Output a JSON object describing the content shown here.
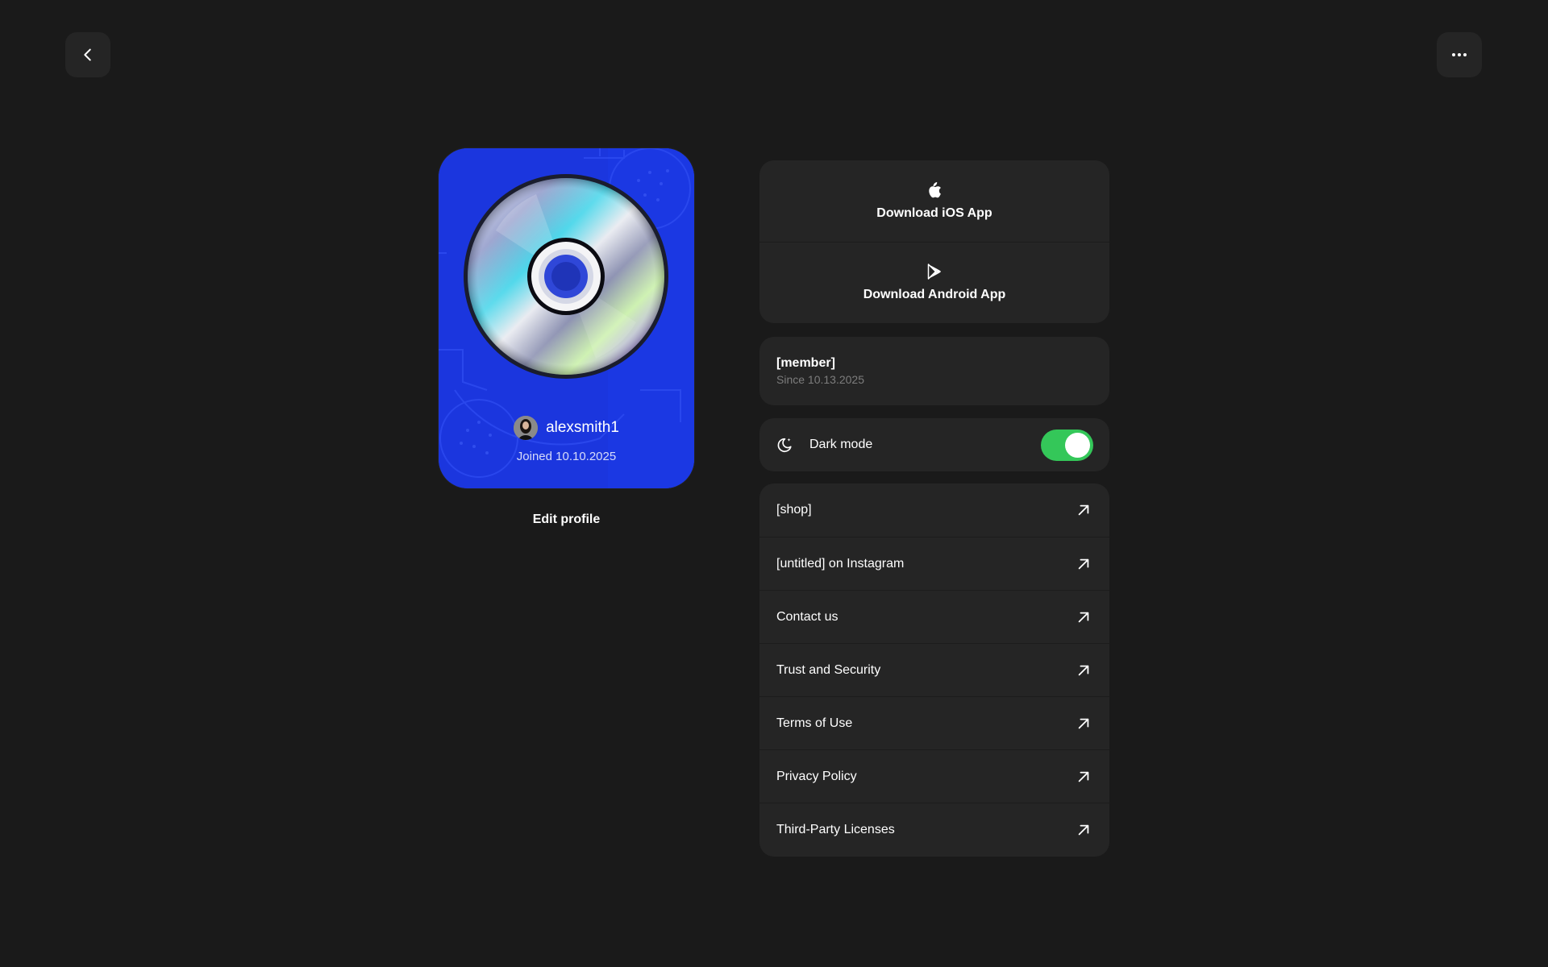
{
  "header": {
    "back_icon": "chevron-left-icon",
    "more_icon": "more-horizontal-icon"
  },
  "profile": {
    "username": "alexsmith1",
    "joined": "Joined 10.10.2025",
    "edit_label": "Edit profile",
    "card_color": "#1b36de"
  },
  "apps": [
    {
      "label": "Download iOS App",
      "icon": "apple-icon"
    },
    {
      "label": "Download Android App",
      "icon": "google-play-icon"
    }
  ],
  "membership": {
    "title": "[member]",
    "since": "Since 10.13.2025"
  },
  "settings": {
    "dark_mode_label": "Dark mode",
    "dark_mode_on": true,
    "toggle_color": "#34c759"
  },
  "links": [
    {
      "label": "[shop]"
    },
    {
      "label": "[untitled] on Instagram"
    },
    {
      "label": "Contact us"
    },
    {
      "label": "Trust and Security"
    },
    {
      "label": "Terms of Use"
    },
    {
      "label": "Privacy Policy"
    },
    {
      "label": "Third-Party Licenses"
    }
  ]
}
